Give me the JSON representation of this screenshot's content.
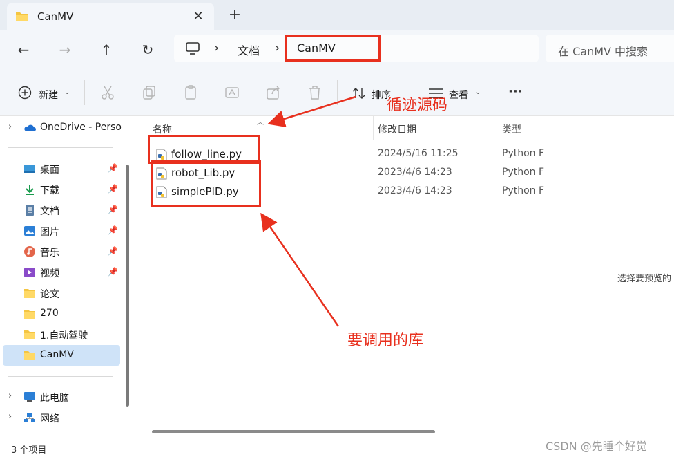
{
  "window": {
    "tab_title": "CanMV",
    "close_glyph": "✕",
    "new_tab_glyph": "+"
  },
  "nav": {
    "back_glyph": "←",
    "forward_glyph": "→",
    "up_glyph": "↑",
    "refresh_glyph": "↻",
    "separator": "›",
    "breadcrumbs": [
      "文档",
      "CanMV"
    ],
    "search_placeholder": "在 CanMV 中搜索"
  },
  "toolbar": {
    "new_label": "新建",
    "sort_label": "排序",
    "view_label": "查看",
    "more_glyph": "···",
    "icons": [
      "cut-icon",
      "copy-icon",
      "paste-icon",
      "rename-icon",
      "share-icon",
      "delete-icon"
    ]
  },
  "sidebar": {
    "onedrive": "OneDrive - Perso",
    "quick_access": [
      {
        "label": "桌面",
        "icon": "desktop-icon",
        "pinned": true
      },
      {
        "label": "下载",
        "icon": "download-icon",
        "pinned": true
      },
      {
        "label": "文档",
        "icon": "documents-icon",
        "pinned": true
      },
      {
        "label": "图片",
        "icon": "pictures-icon",
        "pinned": true
      },
      {
        "label": "音乐",
        "icon": "music-icon",
        "pinned": true
      },
      {
        "label": "视频",
        "icon": "videos-icon",
        "pinned": true
      },
      {
        "label": "论文",
        "icon": "folder-icon",
        "pinned": false
      },
      {
        "label": "270",
        "icon": "folder-icon",
        "pinned": false
      },
      {
        "label": "1.自动驾驶",
        "icon": "folder-icon",
        "pinned": false
      },
      {
        "label": "CanMV",
        "icon": "folder-icon",
        "pinned": false,
        "selected": true
      }
    ],
    "this_pc": "此电脑",
    "network": "网络"
  },
  "filelist": {
    "columns": [
      "名称",
      "修改日期",
      "类型"
    ],
    "files": [
      {
        "name": "follow_line.py",
        "modified": "2024/5/16 11:25",
        "type": "Python F"
      },
      {
        "name": "robot_Lib.py",
        "modified": "2023/4/6 14:23",
        "type": "Python F"
      },
      {
        "name": "simplePID.py",
        "modified": "2023/4/6 14:23",
        "type": "Python F"
      }
    ]
  },
  "preview": {
    "text": "选择要预览的"
  },
  "status": {
    "item_count": "3 个项目"
  },
  "annotations": {
    "source_label": "循迹源码",
    "library_label": "要调用的库",
    "color": "#e8301e"
  },
  "watermark": "CSDN @先睡个好觉"
}
